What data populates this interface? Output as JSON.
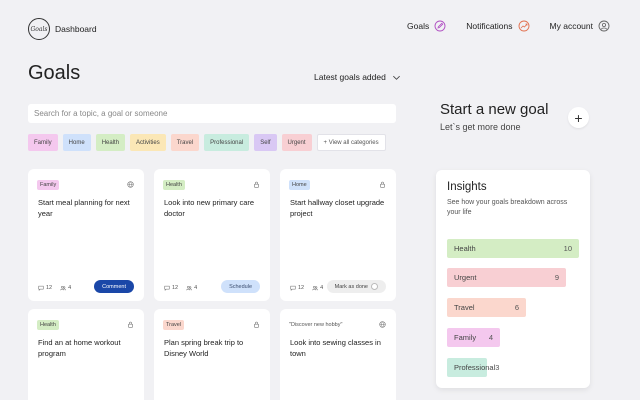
{
  "nav": {
    "logo_text": "Goals",
    "dashboard": "Dashboard",
    "goals": "Goals",
    "notifications": "Notifications",
    "account": "My account"
  },
  "page": {
    "title": "Goals",
    "sort": "Latest goals added",
    "search_placeholder": "Search for a topic, a goal or someone"
  },
  "categories": [
    {
      "label": "Family",
      "color": "#f4c8ee"
    },
    {
      "label": "Home",
      "color": "#cfe1fb"
    },
    {
      "label": "Health",
      "color": "#d4edc4"
    },
    {
      "label": "Activities",
      "color": "#fbe7b6"
    },
    {
      "label": "Travel",
      "color": "#fbd7cd"
    },
    {
      "label": "Professional",
      "color": "#c8ecdf"
    },
    {
      "label": "Self",
      "color": "#d9c8f4"
    },
    {
      "label": "Urgent",
      "color": "#f8cfd3"
    }
  ],
  "view_all": "+ View all categories",
  "cards": [
    {
      "tag": "Family",
      "text": "Start meal planning for next year",
      "comments": "12",
      "people": "4",
      "button": "Comment"
    },
    {
      "tag": "Health",
      "text": "Look into new primary care doctor",
      "comments": "12",
      "people": "4",
      "button": "Schedule"
    },
    {
      "tag": "Home",
      "text": "Start hallway closet upgrade project",
      "comments": "12",
      "people": "4",
      "button": "Mark as done"
    },
    {
      "tag": "Health",
      "text": "Find an at home workout program"
    },
    {
      "tag": "Travel",
      "text": "Plan spring break trip to Disney World"
    },
    {
      "tag": "\"Discover new hobby\"",
      "text": "Look into sewing classes in town"
    }
  ],
  "new_goal": {
    "title": "Start a new goal",
    "subtitle": "Let`s get more done"
  },
  "insights": {
    "title": "Insights",
    "subtitle": "See how your goals breakdown across your life",
    "max_value": 10,
    "bars": [
      {
        "label": "Health",
        "value": "10",
        "color": "#d4edc4"
      },
      {
        "label": "Urgent",
        "value": "9",
        "color": "#f8cfd3"
      },
      {
        "label": "Travel",
        "value": "6",
        "color": "#fbd7cd"
      },
      {
        "label": "Family",
        "value": "4",
        "color": "#f4c8ee"
      },
      {
        "label": "Professional",
        "value": "3",
        "color": "#c8ecdf"
      }
    ]
  },
  "colors": {
    "comment_button": "#1a47a8",
    "schedule_button": "#cfe1fb",
    "done_button": "#eeeeee"
  }
}
